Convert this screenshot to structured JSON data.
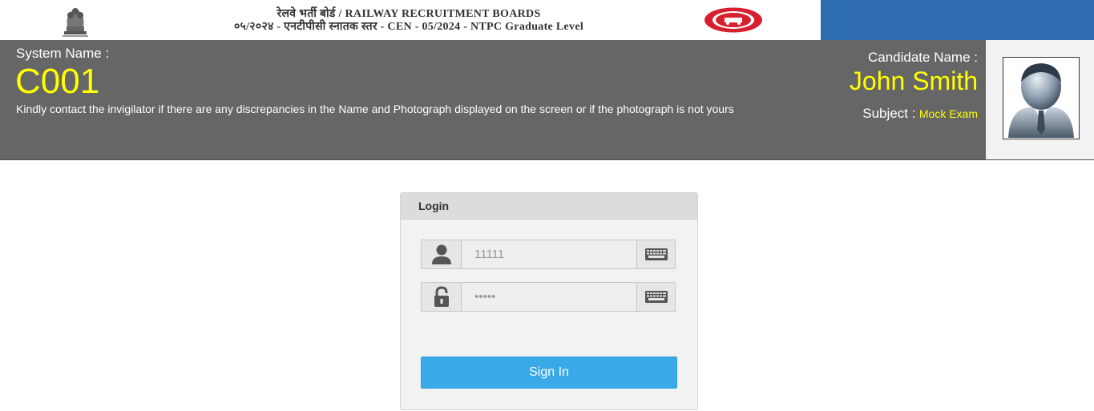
{
  "banner": {
    "line1": "रेलवे भर्ती बोर्ड / RAILWAY RECRUITMENT BOARDS",
    "line2": "०५/२०२४ - एनटीपीसी स्नातक स्तर - CEN - 05/2024 - NTPC Graduate Level",
    "emblem_icon": "national-emblem-icon",
    "logo_icon": "indian-railways-logo-icon",
    "accent_color": "#2f6db3"
  },
  "header": {
    "system_label": "System Name :",
    "system_value": "C001",
    "notice": "Kindly contact the invigilator if there are any discrepancies in the Name and Photograph displayed on the screen or if the photograph is not yours",
    "candidate_label": "Candidate Name :",
    "candidate_value": "John Smith",
    "subject_label": "Subject :",
    "subject_value": "Mock Exam",
    "background_color": "#666666",
    "highlight_color": "#ffff00"
  },
  "login": {
    "title": "Login",
    "username_value": "11111",
    "password_value": "•••••",
    "user_icon": "user-icon",
    "lock_icon": "lock-icon",
    "keyboard_icon": "keyboard-icon",
    "signin_label": "Sign In",
    "button_color": "#3aa9e8"
  }
}
